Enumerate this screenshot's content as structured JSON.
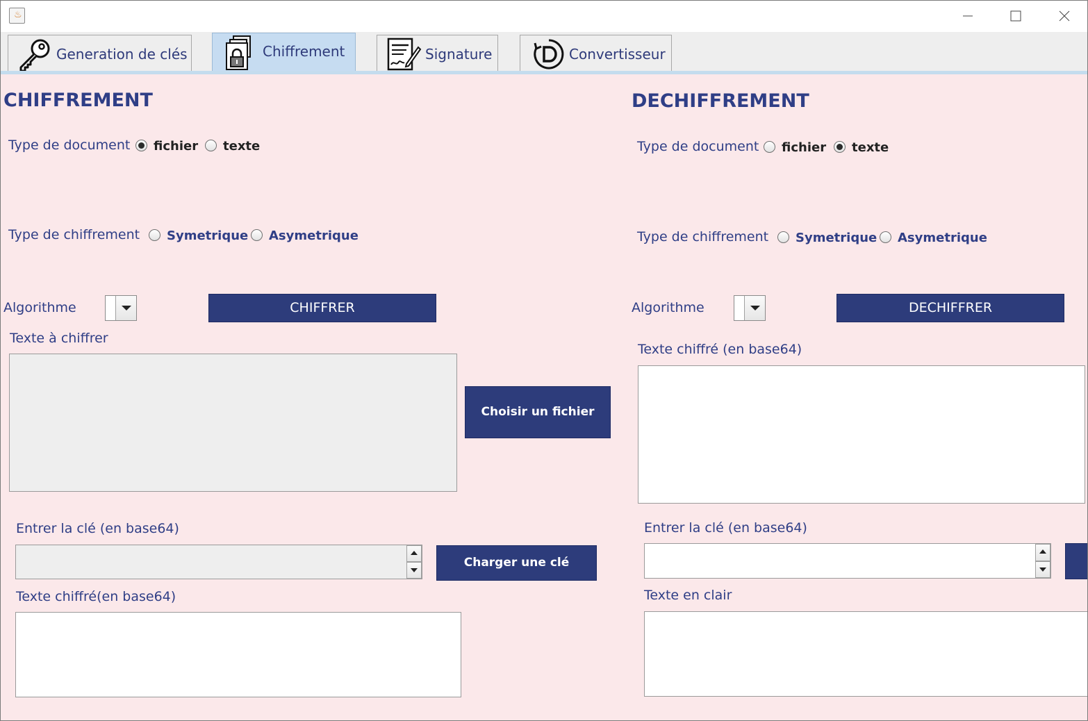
{
  "window": {
    "title": "",
    "app_icon": "java-cup-icon",
    "controls": [
      "minimize-icon",
      "maximize-icon",
      "close-icon"
    ]
  },
  "tabs": [
    {
      "label": "Generation de clés",
      "icon": "key-icon",
      "active": false
    },
    {
      "label": "Chiffrement",
      "icon": "locked-documents-icon",
      "active": true
    },
    {
      "label": "Signature",
      "icon": "signed-document-icon",
      "active": false
    },
    {
      "label": "Convertisseur",
      "icon": "convert-d-icon",
      "active": false
    }
  ],
  "encrypt": {
    "heading": "CHIFFREMENT",
    "doc_type": {
      "label": "Type de document",
      "options": [
        "fichier",
        "texte"
      ],
      "selected": "fichier"
    },
    "cipher_type": {
      "label": "Type de chiffrement",
      "options": [
        "Symetrique",
        "Asymetrique"
      ],
      "selected": ""
    },
    "algorithm_label": "Algorithme",
    "algorithm_value": "",
    "action_button": "CHIFFRER",
    "input_label": "Texte à chiffrer",
    "input_value": "",
    "choose_file_button": "Choisir un fichier",
    "key_label": "Entrer la clé (en base64)",
    "key_value": "",
    "load_key_button": "Charger une clé",
    "output_label": "Texte chiffré(en base64)",
    "output_value": ""
  },
  "decrypt": {
    "heading": "DECHIFFREMENT",
    "doc_type": {
      "label": "Type de document",
      "options": [
        "fichier",
        "texte"
      ],
      "selected": "texte"
    },
    "cipher_type": {
      "label": "Type de chiffrement",
      "options": [
        "Symetrique",
        "Asymetrique"
      ],
      "selected": ""
    },
    "algorithm_label": "Algorithme",
    "algorithm_value": "",
    "action_button": "DECHIFFRER",
    "input_label": "Texte chiffré (en base64)",
    "input_value": "",
    "key_label": "Entrer la clé (en base64)",
    "key_value": "",
    "output_label": "Texte en clair",
    "output_value": ""
  },
  "colors": {
    "panel_bg": "#fbe8ea",
    "label_text": "#2f3e86",
    "button_bg": "#2d3c7b",
    "active_tab": "#c6dcf1"
  }
}
